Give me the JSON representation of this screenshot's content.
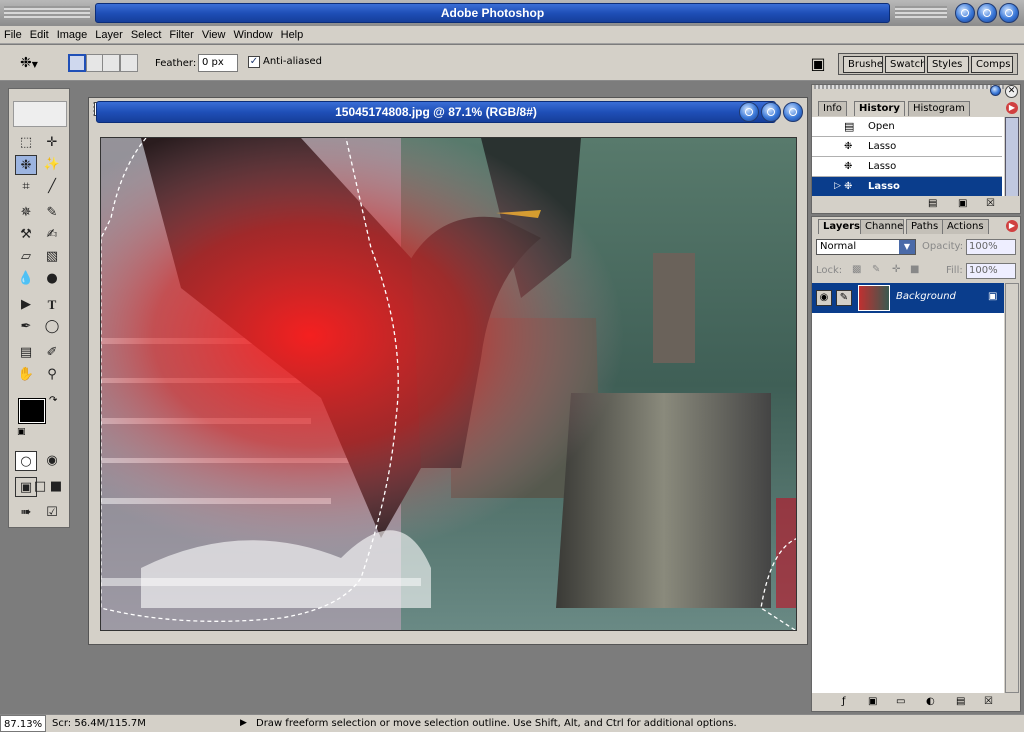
{
  "app": {
    "title": "Adobe Photoshop"
  },
  "menu": [
    "File",
    "Edit",
    "Image",
    "Layer",
    "Select",
    "Filter",
    "View",
    "Window",
    "Help"
  ],
  "options": {
    "feather_label": "Feather:",
    "feather_value": "0 px",
    "antialiased_label": "Anti-aliased",
    "antialiased_checked": true
  },
  "palette_well": [
    "Brushes",
    "Swatches",
    "Styles",
    "Comps"
  ],
  "document": {
    "title": "15045174808.jpg @ 87.1% (RGB/8#)"
  },
  "history_panel": {
    "tabs": [
      "Info",
      "History",
      "Histogram"
    ],
    "active_tab": "History",
    "items": [
      {
        "label": "Open",
        "icon": "document-icon"
      },
      {
        "label": "Lasso",
        "icon": "lasso-icon"
      },
      {
        "label": "Lasso",
        "icon": "lasso-icon"
      },
      {
        "label": "Lasso",
        "icon": "lasso-icon",
        "selected": true
      }
    ]
  },
  "layers_panel": {
    "tabs": [
      "Layers",
      "Channels",
      "Paths",
      "Actions"
    ],
    "active_tab": "Layers",
    "blend_mode": "Normal",
    "opacity_label": "Opacity:",
    "opacity_value": "100%",
    "lock_label": "Lock:",
    "fill_label": "Fill:",
    "fill_value": "100%",
    "layers": [
      {
        "name": "Background",
        "visible": true,
        "locked": true
      }
    ]
  },
  "status": {
    "zoom": "87.13%",
    "scratch": "Scr: 56.4M/115.7M",
    "hint": "Draw freeform selection or move selection outline.  Use Shift, Alt, and Ctrl for additional options."
  },
  "colors": {
    "accent": "#1f4fb7",
    "selection": "#0a3d8c",
    "chrome": "#d4d0c8"
  }
}
